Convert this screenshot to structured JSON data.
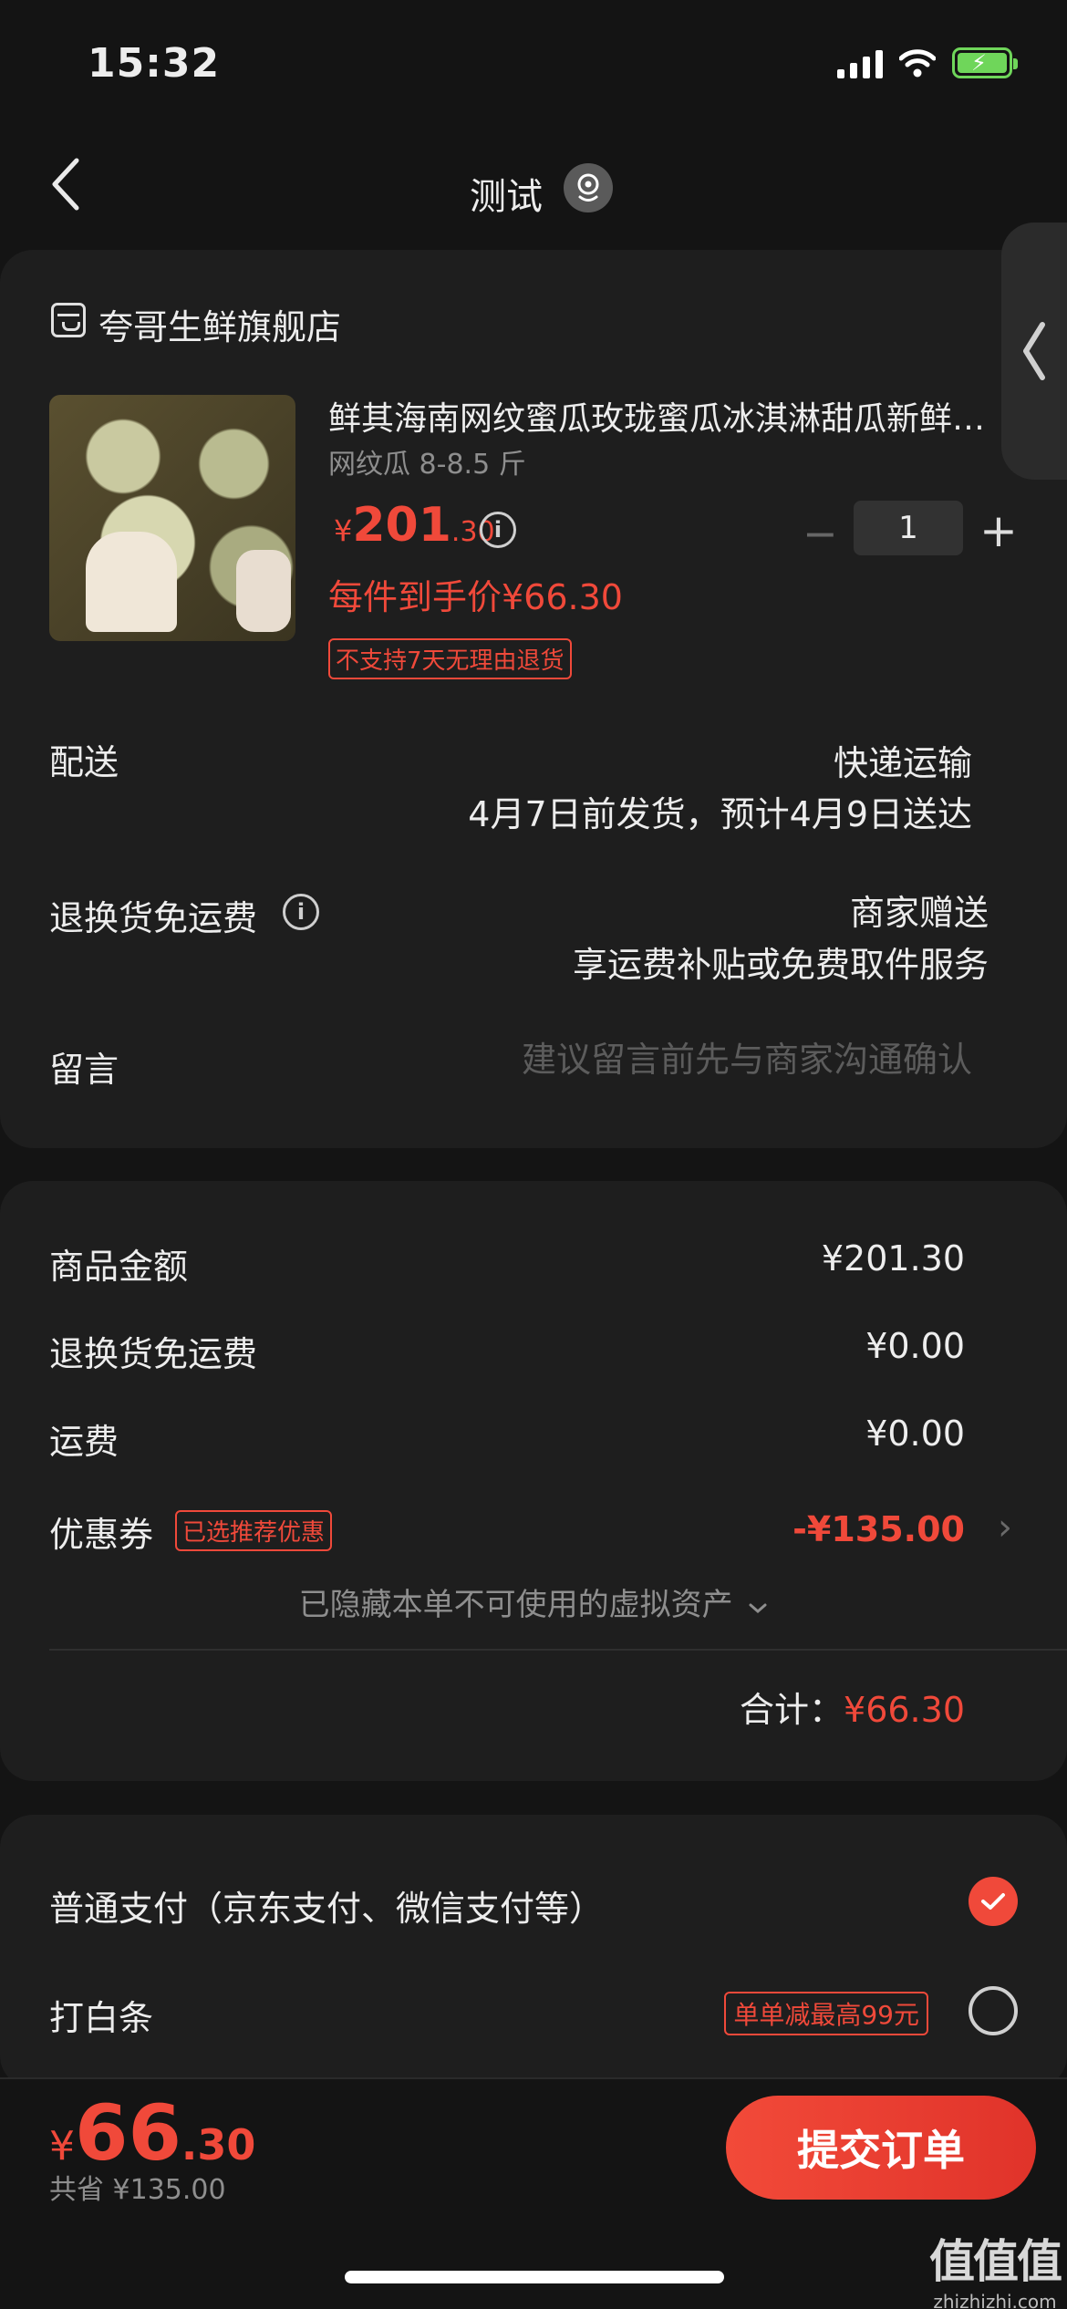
{
  "status_bar": {
    "time": "15:32"
  },
  "nav": {
    "title": "测试"
  },
  "shop": {
    "name": "夸哥生鲜旗舰店"
  },
  "product": {
    "title": "鲜其海南网纹蜜瓜玫珑蜜瓜冰淇淋甜瓜新鲜水果",
    "spec": "网纹瓜 8-8.5 斤",
    "price_symbol": "¥",
    "price_int": "201",
    "price_dec": ".30",
    "unit_price": "每件到手价¥66.30",
    "return_tag": "不支持7天无理由退货",
    "quantity": "1"
  },
  "delivery": {
    "label": "配送",
    "method": "快递运输",
    "date": "4月7日前发货，预计4月9日送达"
  },
  "return_shipping": {
    "label": "退换货免运费",
    "line1": "商家赠送",
    "line2": "享运费补贴或免费取件服务"
  },
  "message": {
    "label": "留言",
    "placeholder": "建议留言前先与商家沟通确认"
  },
  "summary": {
    "goods_label": "商品金额",
    "goods_amount": "¥201.30",
    "return_label": "退换货免运费",
    "return_amount": "¥0.00",
    "freight_label": "运费",
    "freight_amount": "¥0.00",
    "coupon_label": "优惠券",
    "coupon_tag": "已选推荐优惠",
    "coupon_amount": "-¥135.00",
    "hidden_assets": "已隐藏本单不可使用的虚拟资产",
    "total_label": "合计：",
    "total_value": "¥66.30"
  },
  "payment": {
    "option1": "普通支付（京东支付、微信支付等）",
    "option2": "打白条",
    "option2_tag": "单单减最高99元",
    "option1_selected": true
  },
  "footer": {
    "price_symbol": "¥",
    "price_int": "66",
    "price_dec": ".30",
    "saved": "共省 ¥135.00",
    "submit_label": "提交订单"
  },
  "watermark": {
    "big": "值值值",
    "small": "zhizhizhi.com"
  },
  "colors": {
    "accent": "#f0493a",
    "background": "#141414",
    "card": "#1e1e1e"
  },
  "icons": [
    "back-chevron-icon",
    "location-icon",
    "shop-icon",
    "info-icon",
    "check-icon",
    "chevron-right-icon",
    "chevron-down-icon"
  ]
}
